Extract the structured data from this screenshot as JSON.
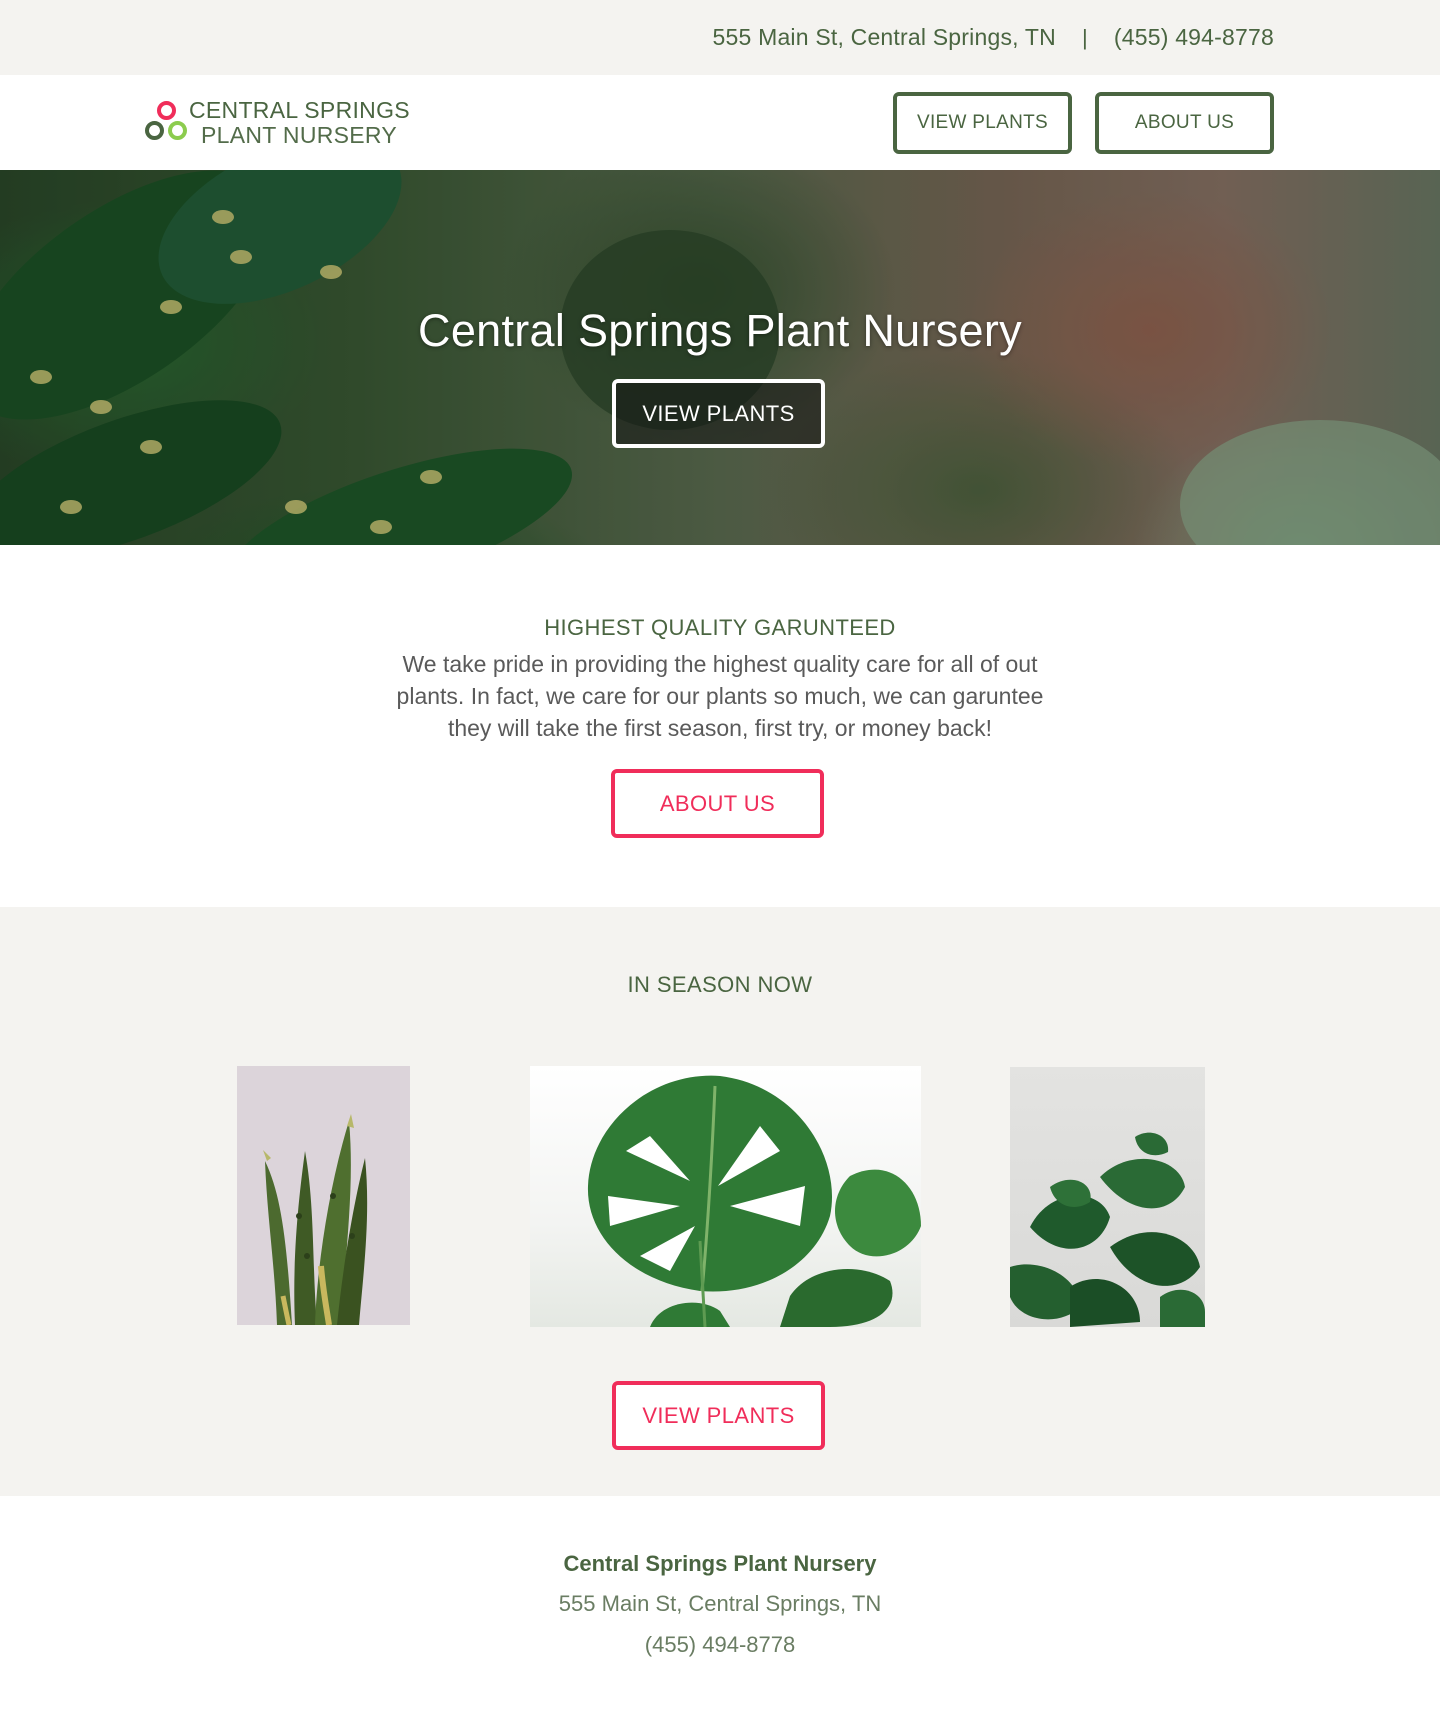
{
  "topbar": {
    "address": "555 Main St, Central Springs, TN",
    "separator": "|",
    "phone": "(455) 494-8778"
  },
  "nav": {
    "logo_line1": "CENTRAL SPRINGS",
    "logo_line2": "PLANT NURSERY",
    "view_plants_label": "VIEW PLANTS",
    "about_us_label": "ABOUT US"
  },
  "hero": {
    "title": "Central Springs Plant Nursery",
    "button_label": "VIEW PLANTS"
  },
  "about": {
    "heading": "HIGHEST QUALITY GARUNTEED",
    "body": "We take pride in providing the highest quality care for all of out plants. In fact, we care for our plants so much, we can garuntee they will take the first season, first try, or money back!",
    "button_label": "ABOUT US"
  },
  "season": {
    "heading": "IN SEASON NOW",
    "button_label": "VIEW PLANTS"
  },
  "footer": {
    "name": "Central Springs Plant Nursery",
    "address": "555 Main St, Central Springs, TN",
    "phone": "(455) 494-8778"
  },
  "colors": {
    "brand_green": "#4a6541",
    "accent_pink": "#f02d5a",
    "light_green": "#8ccc4e",
    "band_bg": "#f4f3f0"
  }
}
